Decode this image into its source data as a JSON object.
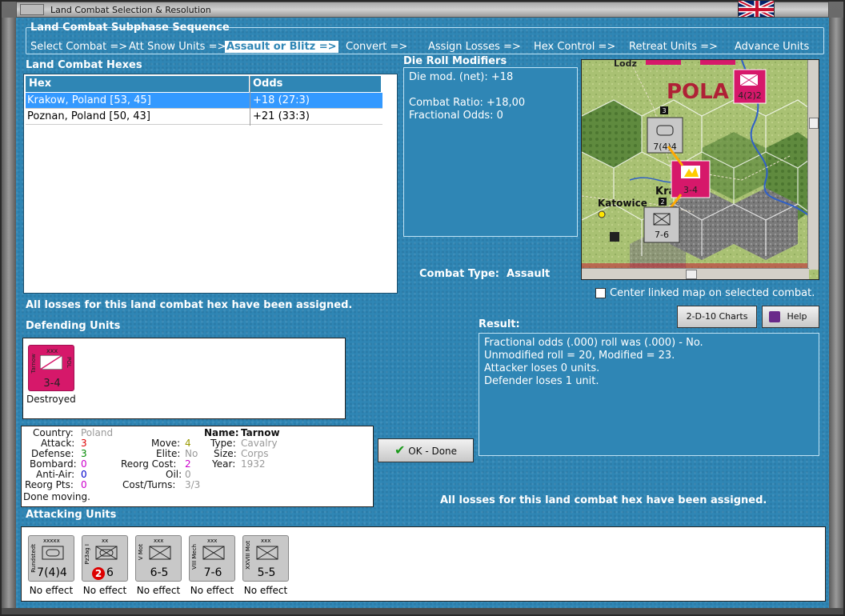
{
  "window": {
    "title": "Land Combat Selection & Resolution"
  },
  "sequence": {
    "title": "Land Combat Subphase Sequence",
    "steps": [
      "Select Combat =>",
      "Att Snow Units =>",
      "Assault or Blitz =>",
      "Convert =>",
      "Assign Losses =>",
      "Hex Control =>",
      "Retreat Units =>",
      "Advance Units"
    ]
  },
  "hexes": {
    "title": "Land Combat Hexes",
    "columns": [
      "Hex",
      "Odds"
    ],
    "rows": [
      {
        "hex": "Krakow, Poland [53, 45]",
        "odds": "+18 (27:3)"
      },
      {
        "hex": "Poznan, Poland [50, 43]",
        "odds": "+21 (33:3)"
      }
    ]
  },
  "die": {
    "title": "Die Roll Modifiers",
    "line1": "Die mod. (net): +18",
    "line2": "Combat Ratio: +18,00",
    "line3": "Fractional Odds: 0"
  },
  "combat_type": {
    "label": "Combat Type:",
    "value": "Assault"
  },
  "center_map": {
    "label": "Center linked map on selected combat.",
    "checked": false
  },
  "assigned_msg": "All losses for this land combat hex have been assigned.",
  "defending": {
    "title": "Defending Units",
    "units": [
      {
        "size": "xxx",
        "name": "Tarnow",
        "nat": "POL",
        "strength": "3-4",
        "status": "Destroyed"
      }
    ]
  },
  "result": {
    "title": "Result:",
    "lines": [
      "Fractional odds (.000) roll was (.000)  - No.",
      "Unmodified roll = 20, Modified = 23.",
      "Attacker loses 0 units.",
      "Defender loses 1 unit."
    ]
  },
  "buttons": {
    "charts": "2-D-10 Charts",
    "help": "Help",
    "ok": "OK - Done"
  },
  "info": {
    "country_l": "Country:",
    "country": "Poland",
    "attack_l": "Attack:",
    "attack": "3",
    "defense_l": "Defense:",
    "defense": "3",
    "bombard_l": "Bombard:",
    "bombard": "0",
    "antiair_l": "Anti-Air:",
    "antiair": "0",
    "reorgpts_l": "Reorg Pts:",
    "reorgpts": "0",
    "done": "Done moving.",
    "move_l": "Move:",
    "move": "4",
    "elite_l": "Elite:",
    "elite": "No",
    "reorgcost_l": "Reorg Cost:",
    "reorgcost": "2",
    "oil_l": "Oil:",
    "oil": "0",
    "costturns_l": "Cost/Turns:",
    "costturns": "3/3",
    "name_l": "Name:",
    "name": "Tarnow",
    "type_l": "Type:",
    "type": "Cavalry",
    "size_l": "Size:",
    "size": "Corps",
    "year_l": "Year:",
    "year": "1932"
  },
  "attacking": {
    "title": "Attacking Units",
    "units": [
      {
        "size": "xxxxx",
        "name": "Rundstedt",
        "strength": "7(4)4",
        "status": "No effect"
      },
      {
        "size": "xx",
        "name": "Pz3ag I",
        "strength": "6",
        "badge": "2",
        "status": "No effect"
      },
      {
        "size": "xxx",
        "name": "V Mot",
        "strength": "6-5",
        "status": "No effect"
      },
      {
        "size": "xxx",
        "name": "VIII Mech",
        "strength": "7-6",
        "status": "No effect"
      },
      {
        "size": "xxx",
        "name": "XXVIII Mot",
        "strength": "5-5",
        "status": "No effect"
      }
    ]
  },
  "map": {
    "labels": [
      "POLA",
      "Kra",
      "Katowice",
      "Lodz"
    ],
    "units": [
      {
        "strength": "4(2)2",
        "size": "xxx"
      },
      {
        "strength": "7(4)4",
        "size": "xxxxx",
        "stack": "3"
      },
      {
        "strength": "3-4",
        "size": "xxx"
      },
      {
        "strength": "7-6",
        "size": "xxx",
        "stack": "2"
      }
    ]
  },
  "colors": {
    "panel": "#2f86b5",
    "selected": "#3399ff",
    "defender": "#d6186a",
    "attacker": "#c8c8c8"
  }
}
